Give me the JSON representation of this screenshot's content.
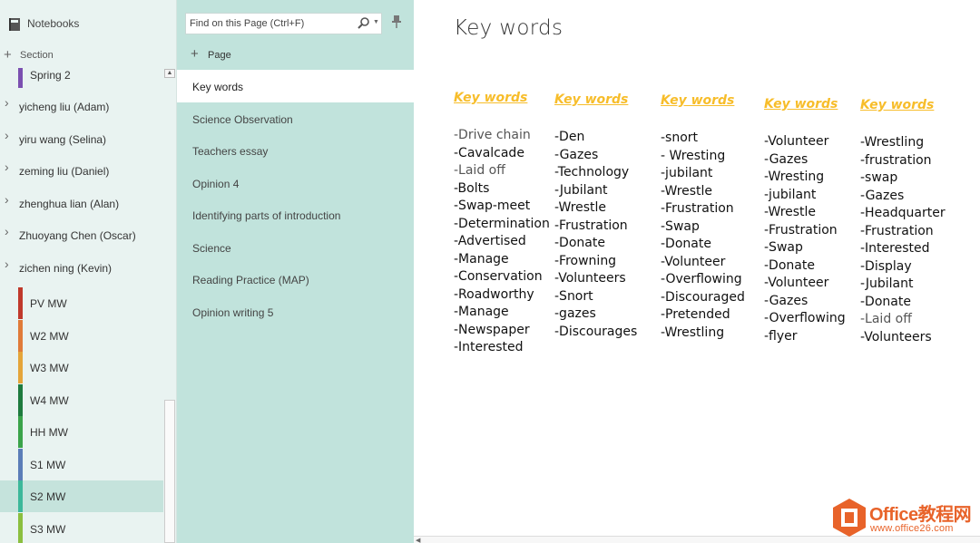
{
  "notebooks_pane": {
    "header_label": "Notebooks",
    "add_section_label": "Section",
    "items": [
      {
        "kind": "section",
        "label": "Spring 2",
        "color": "#7b4fb0"
      },
      {
        "kind": "group",
        "label": "yicheng liu (Adam)"
      },
      {
        "kind": "group",
        "label": "yiru wang (Selina)"
      },
      {
        "kind": "group",
        "label": "zeming liu (Daniel)"
      },
      {
        "kind": "group",
        "label": "zhenghua lian (Alan)"
      },
      {
        "kind": "group",
        "label": "Zhuoyang Chen (Oscar)"
      },
      {
        "kind": "group",
        "label": "zichen ning (Kevin)"
      },
      {
        "kind": "section",
        "label": "PV MW",
        "color": "#c0392b"
      },
      {
        "kind": "section",
        "label": "W2 MW",
        "color": "#e07b39"
      },
      {
        "kind": "section",
        "label": "W3 MW",
        "color": "#e5a53a"
      },
      {
        "kind": "section",
        "label": "W4 MW",
        "color": "#1e7b3e"
      },
      {
        "kind": "section",
        "label": "HH MW",
        "color": "#3aa34a"
      },
      {
        "kind": "section",
        "label": "S1 MW",
        "color": "#5b7db8"
      },
      {
        "kind": "section",
        "label": "S2 MW",
        "color": "#3cb89a",
        "selected": true
      },
      {
        "kind": "section",
        "label": "S3 MW",
        "color": "#8bbf3f"
      }
    ]
  },
  "pages_pane": {
    "search_placeholder": "Find on this Page (Ctrl+F)",
    "add_page_label": "Page",
    "pages": [
      {
        "label": "Key words",
        "selected": true
      },
      {
        "label": "Science Observation"
      },
      {
        "label": "Teachers essay"
      },
      {
        "label": "Opinion 4"
      },
      {
        "label": "Identifying parts of introduction"
      },
      {
        "label": "Science"
      },
      {
        "label": "Reading Practice (MAP)"
      },
      {
        "label": "Opinion writing 5"
      }
    ]
  },
  "content": {
    "title": "Key words",
    "heading_color": "#f7bd2a",
    "columns": [
      {
        "heading": "Key words",
        "words": [
          "-Drive chain",
          "-Cavalcade",
          "-Laid off",
          "-Bolts",
          "-Swap-meet",
          "-Determination",
          "-Advertised",
          "-Manage",
          "-Conservation",
          "-Roadworthy",
          "-Manage",
          "-Newspaper",
          "-Interested"
        ]
      },
      {
        "heading": "Key words",
        "words": [
          "-Den",
          "-Gazes",
          "-Technology",
          "-Jubilant",
          "-Wrestle",
          "-Frustration",
          "-Donate",
          "-Frowning",
          "-Volunteers",
          "-Snort",
          "-gazes",
          "-Discourages"
        ]
      },
      {
        "heading": "Key words",
        "words": [
          "-snort",
          "- Wresting",
          "-jubilant",
          "-Wrestle",
          "-Frustration",
          "-Swap",
          "-Donate",
          "-Volunteer",
          "-Overflowing",
          "-Discouraged",
          "-Pretended",
          "-Wrestling"
        ]
      },
      {
        "heading": "Key words",
        "words": [
          "-Volunteer",
          "-Gazes",
          "-Wresting",
          "-jubilant",
          "-Wrestle",
          "-Frustration",
          "-Swap",
          "-Donate",
          "-Volunteer",
          "-Gazes",
          "-Overflowing",
          "-flyer"
        ]
      },
      {
        "heading": "Key words",
        "words": [
          "-Wrestling",
          "-frustration",
          "-swap",
          "-Gazes",
          "-Headquarter",
          "-Frustration",
          "-Interested",
          "-Display",
          "-Jubilant",
          "-Donate",
          "-Laid off",
          "-Volunteers"
        ]
      }
    ]
  },
  "watermark": {
    "brand": "Office教程网",
    "url": "www.office26.com"
  }
}
